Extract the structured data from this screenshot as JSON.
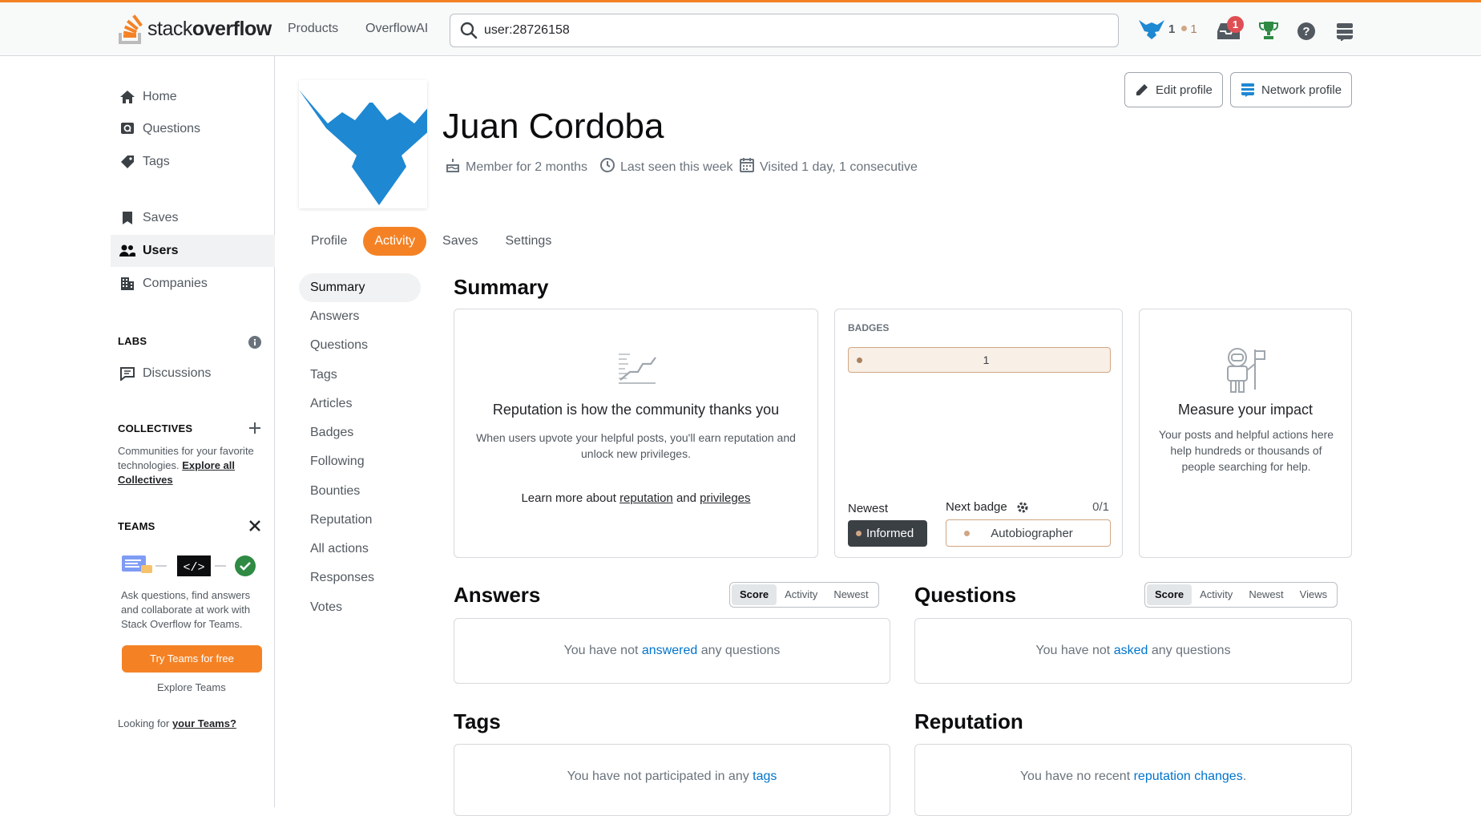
{
  "topbar": {
    "logo_light": "stack",
    "logo_bold": "overflow",
    "nav": [
      "Products",
      "OverflowAI"
    ],
    "search_value": "user:28726158",
    "reputation": "1",
    "bronze_count": "1",
    "inbox_count": "1"
  },
  "sidebar": {
    "items": [
      {
        "label": "Home",
        "icon": "home-icon"
      },
      {
        "label": "Questions",
        "icon": "questions-icon"
      },
      {
        "label": "Tags",
        "icon": "tag-icon"
      },
      {
        "label": "Saves",
        "icon": "bookmark-icon"
      },
      {
        "label": "Users",
        "icon": "users-icon"
      },
      {
        "label": "Companies",
        "icon": "building-icon"
      }
    ],
    "labs_title": "LABS",
    "discussions": "Discussions",
    "collectives_title": "COLLECTIVES",
    "collectives_text": "Communities for your favorite technologies.",
    "collectives_link": "Explore all Collectives",
    "teams_title": "TEAMS",
    "teams_text": "Ask questions, find answers and collaborate at work with Stack Overflow for Teams.",
    "teams_button": "Try Teams for free",
    "explore_teams": "Explore Teams",
    "looking_for": "Looking for",
    "your_teams": "your Teams?"
  },
  "profile": {
    "name": "Juan Cordoba",
    "member_for": "Member for 2 months",
    "last_seen": "Last seen this week",
    "visited": "Visited 1 day, 1 consecutive",
    "edit_profile": "Edit profile",
    "network_profile": "Network profile"
  },
  "tabs": [
    {
      "label": "Profile",
      "active": false
    },
    {
      "label": "Activity",
      "active": true
    },
    {
      "label": "Saves",
      "active": false
    },
    {
      "label": "Settings",
      "active": false
    }
  ],
  "subnav": [
    "Summary",
    "Answers",
    "Questions",
    "Tags",
    "Articles",
    "Badges",
    "Following",
    "Bounties",
    "Reputation",
    "All actions",
    "Responses",
    "Votes"
  ],
  "summary": {
    "title": "Summary",
    "rep_heading": "Reputation is how the community thanks you",
    "rep_text": "When users upvote your helpful posts, you'll earn reputation and unlock new privileges.",
    "learn_more": "Learn more about",
    "reputation_link": "reputation",
    "and": "and",
    "privileges_link": "privileges",
    "badges_title": "BADGES",
    "bronze_badges": "1",
    "newest_label": "Newest",
    "newest_badge": "Informed",
    "next_badge_label": "Next badge",
    "next_badge_progress": "0/1",
    "next_badge": "Autobiographer",
    "impact_heading": "Measure your impact",
    "impact_text": "Your posts and helpful actions here help hundreds or thousands of people searching for help."
  },
  "answers": {
    "title": "Answers",
    "sort": [
      "Score",
      "Activity",
      "Newest"
    ],
    "empty_pre": "You have not",
    "empty_link": "answered",
    "empty_post": "any questions"
  },
  "questions": {
    "title": "Questions",
    "sort": [
      "Score",
      "Activity",
      "Newest",
      "Views"
    ],
    "empty_pre": "You have not",
    "empty_link": "asked",
    "empty_post": "any questions"
  },
  "tags_section": {
    "title": "Tags",
    "empty_pre": "You have not participated in any",
    "empty_link": "tags"
  },
  "reputation_section": {
    "title": "Reputation",
    "empty_pre": "You have no recent",
    "empty_link": "reputation changes",
    "empty_post": "."
  },
  "colors": {
    "accent": "#f48225",
    "link": "#0074cc",
    "bronze": "#d1a684",
    "brand_blue": "#1e88d2"
  }
}
